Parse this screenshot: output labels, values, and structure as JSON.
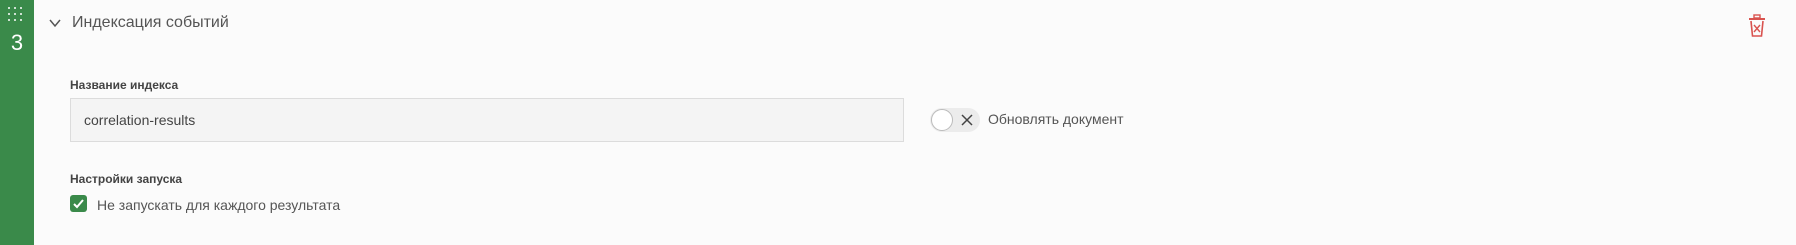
{
  "step": {
    "number": "3",
    "accent_color": "#3a8a4a",
    "drag_icon": "drag-grip-icon"
  },
  "header": {
    "title": "Индексация событий",
    "expanded": true,
    "delete_icon": "trash-icon",
    "delete_color": "#d9534f"
  },
  "index_name": {
    "label": "Название индекса",
    "value": "correlation-results"
  },
  "update_document": {
    "label": "Обновлять документ",
    "enabled": false
  },
  "launch_settings": {
    "label": "Настройки запуска",
    "dont_run_each_result": {
      "label": "Не запускать для каждого результата",
      "checked": true
    }
  }
}
